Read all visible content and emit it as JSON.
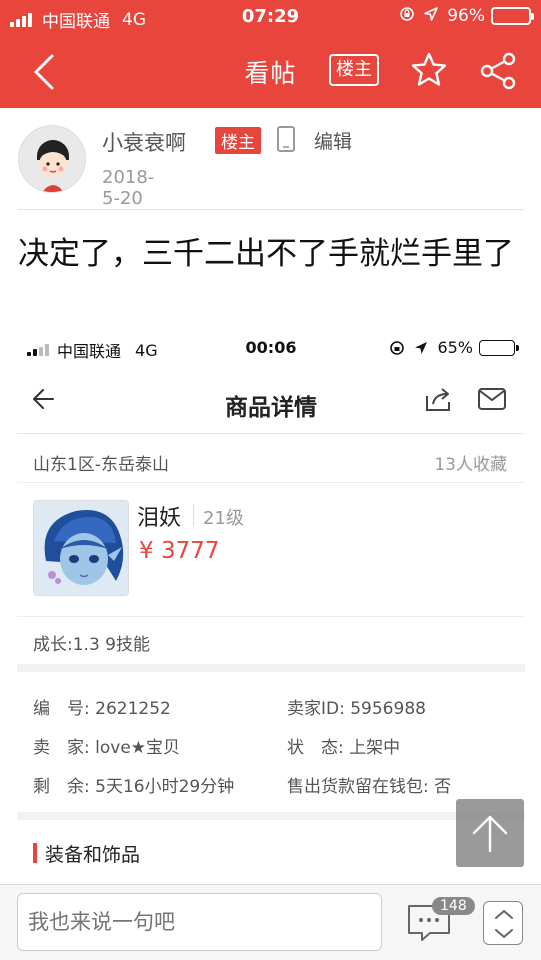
{
  "status_bar": {
    "carrier": "中国联通",
    "network": "4G",
    "time": "07:29",
    "battery": "96%",
    "battery_level": 0.96
  },
  "nav": {
    "title": "看帖",
    "owner_button": "楼主"
  },
  "author": {
    "name": "小衰衰啊",
    "tag": "楼主",
    "edit": "编辑",
    "date": "2018-5-20"
  },
  "post": {
    "title": "决定了，三千二出不了手就烂手里了"
  },
  "screenshot": {
    "status_bar": {
      "carrier": "中国联通",
      "network": "4G",
      "time": "00:06",
      "battery": "65%",
      "battery_level": 0.65
    },
    "title": "商品详情",
    "server": "山东1区-东岳泰山",
    "favorites": "13人收藏",
    "pet_name": "泪妖",
    "pet_level": "21级",
    "price": "¥ 3777",
    "growth": "成长:1.3 9技能",
    "info": {
      "number": "编　号: 2621252",
      "seller_id": "卖家ID: 5956988",
      "seller": "卖　家: love★宝贝",
      "state": "状　态: 上架中",
      "remaining": "剩　余: 5天16小时29分钟",
      "wallet": "售出货款留在钱包: 否"
    },
    "section": "装备和饰品"
  },
  "bottom": {
    "comment_placeholder": "我也来说一句吧",
    "comment_count": "148"
  },
  "colors": {
    "accent": "#e8453d"
  }
}
